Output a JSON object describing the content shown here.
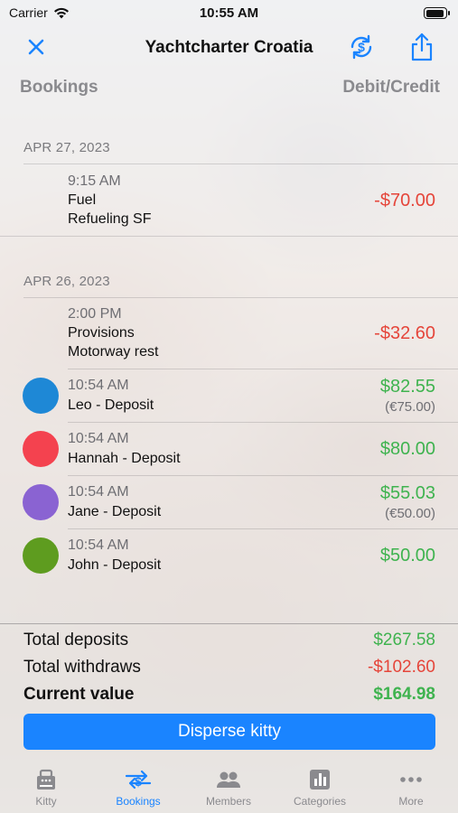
{
  "status": {
    "carrier": "Carrier",
    "time": "10:55 AM"
  },
  "nav": {
    "title": "Yachtcharter Croatia"
  },
  "columns": {
    "left": "Bookings",
    "right": "Debit/Credit"
  },
  "sections": [
    {
      "date": "APR 27, 2023"
    },
    {
      "date": "APR 26, 2023"
    }
  ],
  "rows": [
    {
      "time": "9:15 AM",
      "line1": "Fuel",
      "line2": "Refueling SF",
      "amount": "-$70.00"
    },
    {
      "time": "2:00 PM",
      "line1": "Provisions",
      "line2": "Motorway rest",
      "amount": "-$32.60"
    },
    {
      "time": "10:54 AM",
      "line1": "Leo - Deposit",
      "amount": "$82.55",
      "sub": "(€75.00)",
      "color": "#1e88d6"
    },
    {
      "time": "10:54 AM",
      "line1": "Hannah - Deposit",
      "amount": "$80.00",
      "color": "#f4424f"
    },
    {
      "time": "10:54 AM",
      "line1": "Jane - Deposit",
      "amount": "$55.03",
      "sub": "(€50.00)",
      "color": "#8a63d2"
    },
    {
      "time": "10:54 AM",
      "line1": "John - Deposit",
      "amount": "$50.00",
      "color": "#5e9c1f"
    }
  ],
  "totals": {
    "deposits_label": "Total deposits",
    "deposits": "$267.58",
    "withdraws_label": "Total withdraws",
    "withdraws": "-$102.60",
    "current_label": "Current value",
    "current": "$164.98"
  },
  "disperse_label": "Disperse kitty",
  "tabs": [
    {
      "label": "Kitty",
      "icon": "kitty-icon"
    },
    {
      "label": "Bookings",
      "icon": "bookings-icon"
    },
    {
      "label": "Members",
      "icon": "members-icon"
    },
    {
      "label": "Categories",
      "icon": "categories-icon"
    },
    {
      "label": "More",
      "icon": "more-icon"
    }
  ],
  "colors": {
    "accent": "#1a84ff",
    "debit": "#e5453a",
    "credit": "#3fb34f"
  }
}
